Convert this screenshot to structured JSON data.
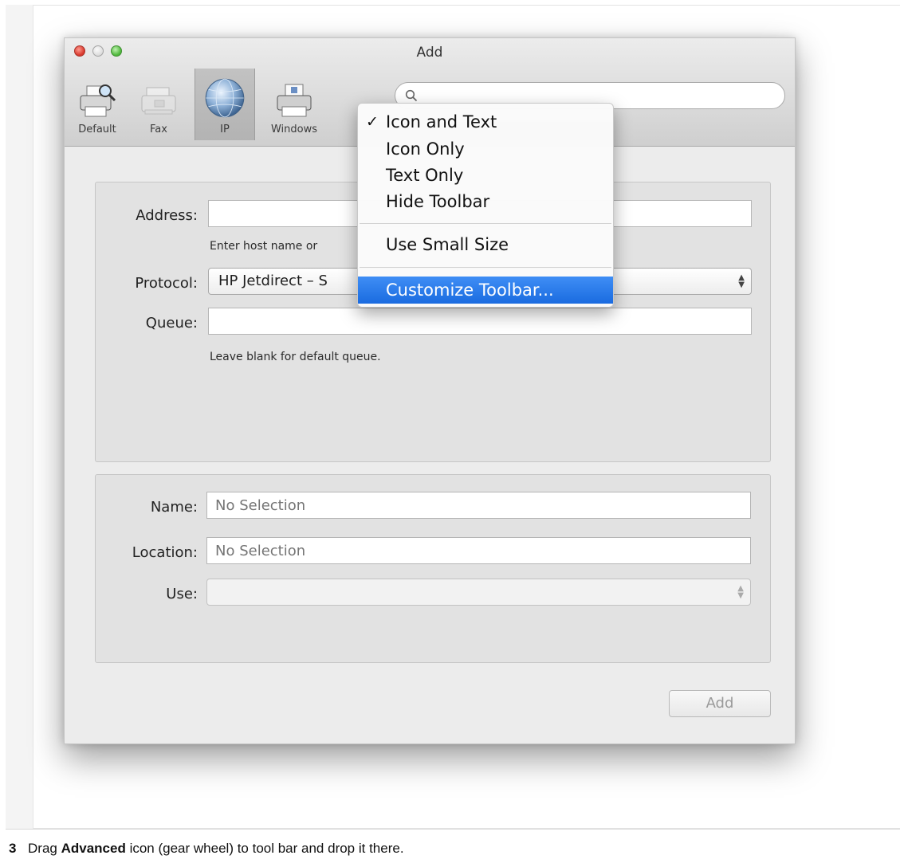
{
  "window": {
    "title": "Add"
  },
  "toolbar": {
    "items": [
      {
        "label": "Default",
        "icon": "printer-magnifier-icon",
        "selected": false
      },
      {
        "label": "Fax",
        "icon": "fax-icon",
        "selected": false
      },
      {
        "label": "IP",
        "icon": "globe-icon",
        "selected": true
      },
      {
        "label": "Windows",
        "icon": "windows-printer-icon",
        "selected": false
      }
    ],
    "search": {
      "placeholder": "",
      "icon": "search-icon"
    }
  },
  "context_menu": {
    "items": [
      {
        "label": "Icon and Text",
        "checked": true,
        "check_mark": "✓"
      },
      {
        "label": "Icon Only"
      },
      {
        "label": "Text Only"
      },
      {
        "label": "Hide Toolbar"
      },
      {
        "label": "Use Small Size"
      },
      {
        "label": "Customize Toolbar...",
        "highlighted": true
      }
    ]
  },
  "form": {
    "address": {
      "label": "Address:",
      "value": "",
      "hint": "Enter host name or"
    },
    "protocol": {
      "label": "Protocol:",
      "value": "HP Jetdirect – S"
    },
    "queue": {
      "label": "Queue:",
      "value": "",
      "hint": "Leave blank for default queue."
    }
  },
  "details": {
    "name": {
      "label": "Name:",
      "placeholder": "No Selection"
    },
    "location": {
      "label": "Location:",
      "placeholder": "No Selection"
    },
    "use": {
      "label": "Use:",
      "value": ""
    }
  },
  "add_button": {
    "label": "Add"
  },
  "instruction": {
    "number": "3",
    "prefix": "Drag",
    "bold": "Advanced",
    "suffix": "icon (gear wheel) to tool bar and drop it there."
  }
}
